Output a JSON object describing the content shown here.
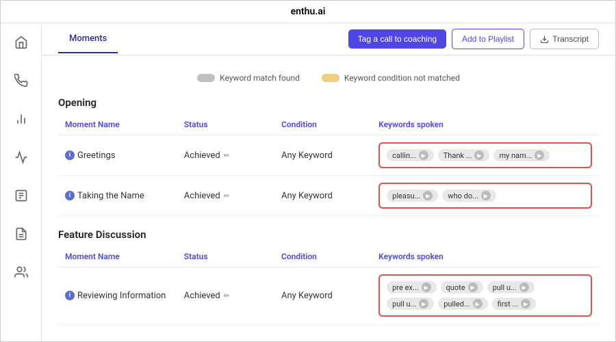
{
  "app": {
    "title": "enthu.ai"
  },
  "sidebar": {
    "items": [
      {
        "name": "home-icon",
        "label": "Home"
      },
      {
        "name": "phone-icon",
        "label": "Phone"
      },
      {
        "name": "chart-icon",
        "label": "Analytics"
      },
      {
        "name": "activity-icon",
        "label": "Activity"
      },
      {
        "name": "document-icon",
        "label": "Documents"
      },
      {
        "name": "report-icon",
        "label": "Reports"
      },
      {
        "name": "users-icon",
        "label": "Users"
      }
    ]
  },
  "tabs": {
    "active": "Moments",
    "items": [
      "Moments"
    ]
  },
  "actions": {
    "tag_label": "Tag a call to coaching",
    "playlist_label": "Add to Playlist",
    "transcript_label": "Transcript"
  },
  "legend": {
    "keyword_match": "Keyword match found",
    "keyword_condition": "Keyword condition not matched"
  },
  "sections": [
    {
      "name": "Opening",
      "columns": {
        "moment_name": "Moment Name",
        "status": "Status",
        "condition": "Condition",
        "keywords": "Keywords spoken"
      },
      "rows": [
        {
          "moment": "Greetings",
          "status": "Achieved",
          "condition": "Any Keyword",
          "keywords": [
            {
              "text": "callin...",
              "has_play": true
            },
            {
              "text": "Thank ...",
              "has_play": true
            },
            {
              "text": "my nam...",
              "has_play": true
            }
          ]
        },
        {
          "moment": "Taking the Name",
          "status": "Achieved",
          "condition": "Any Keyword",
          "keywords": [
            {
              "text": "pleasu...",
              "has_play": true
            },
            {
              "text": "who do...",
              "has_play": true
            }
          ]
        }
      ]
    },
    {
      "name": "Feature Discussion",
      "columns": {
        "moment_name": "Moment Name",
        "status": "Status",
        "condition": "Condition",
        "keywords": "Keywords spoken"
      },
      "rows": [
        {
          "moment": "Reviewing Information",
          "status": "Achieved",
          "condition": "Any Keyword",
          "keywords": [
            {
              "text": "pre ex...",
              "has_play": true
            },
            {
              "text": "quote",
              "has_play": true
            },
            {
              "text": "pull u...",
              "has_play": true
            },
            {
              "text": "pull u...",
              "has_play": true
            },
            {
              "text": "pulled...",
              "has_play": true
            },
            {
              "text": "first ...",
              "has_play": true
            }
          ]
        }
      ]
    }
  ]
}
